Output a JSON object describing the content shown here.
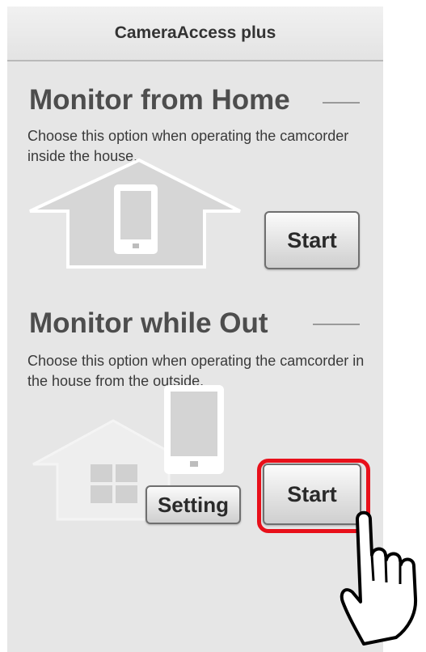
{
  "app": {
    "title": "CameraAccess plus"
  },
  "home": {
    "title": "Monitor from Home",
    "description": "Choose this option when operating the camcorder inside the house.",
    "start_label": "Start"
  },
  "out": {
    "title": "Monitor while Out",
    "description": "Choose this option when operating the camcorder in the house from the outside.",
    "start_label": "Start",
    "setting_label": "Setting"
  },
  "colors": {
    "highlight": "#e8101a",
    "background": "#e6e6e6"
  },
  "icons": [
    "house-phone-icon",
    "house-window-icon",
    "phone-icon",
    "pointing-hand-icon"
  ]
}
